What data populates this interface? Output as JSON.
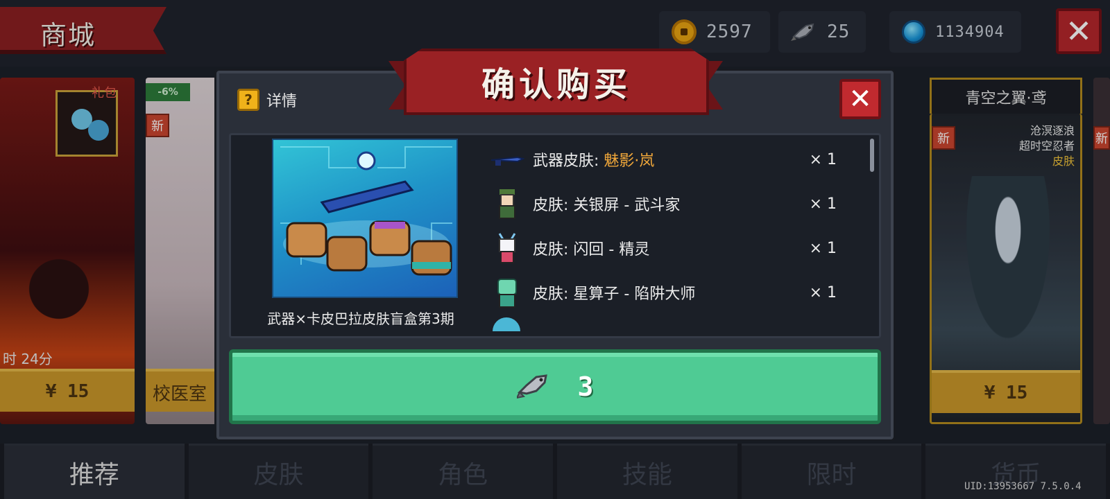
{
  "header": {
    "shop_title": "商城",
    "currencies": [
      {
        "icon": "gold-coin-icon",
        "value": "2597"
      },
      {
        "icon": "fish-icon",
        "value": "25"
      },
      {
        "icon": "blue-gem-icon",
        "value": "1134904"
      }
    ],
    "close_label": "✕"
  },
  "cards": {
    "left": {
      "gift_label": "礼包",
      "timer": "时 24分",
      "price": "¥ 15"
    },
    "mid": {
      "discount": "-6%",
      "new_tag": "新",
      "label": "校医室"
    },
    "right": {
      "title": "青空之翼·鸢",
      "new_tag": "新",
      "lines": [
        "沧溟逐浪",
        "超时空忍者"
      ],
      "type_label": "皮肤",
      "price": "¥ 15"
    },
    "far": {
      "new_tag": "新"
    }
  },
  "modal": {
    "title": "确认购买",
    "detail_label": "详情",
    "qmark": "?",
    "close_label": "✕",
    "preview_name": "武器×卡皮巴拉皮肤盲盒第3期",
    "items": [
      {
        "prefix": "武器皮肤: ",
        "highlight": "魅影·岚",
        "qty": "× 1",
        "icon": "weapon-skin-icon"
      },
      {
        "prefix": "皮肤: 关银屏 - 武斗家",
        "highlight": "",
        "qty": "× 1",
        "icon": "character-skin-icon"
      },
      {
        "prefix": "皮肤: 闪回 - 精灵",
        "highlight": "",
        "qty": "× 1",
        "icon": "character-skin-icon"
      },
      {
        "prefix": "皮肤: 星算子 - 陷阱大师",
        "highlight": "",
        "qty": "× 1",
        "icon": "character-skin-icon"
      }
    ],
    "buy_price": "3",
    "buy_icon": "fish-icon"
  },
  "nav": {
    "tabs": [
      "推荐",
      "皮肤",
      "角色",
      "技能",
      "限时",
      "货币"
    ],
    "active": 0
  },
  "footer": {
    "uid": "UID:13953667 7.5.0.4"
  },
  "colors": {
    "accent_red": "#9a2124",
    "buy_green": "#4fcb94",
    "gold": "#c8962a"
  }
}
